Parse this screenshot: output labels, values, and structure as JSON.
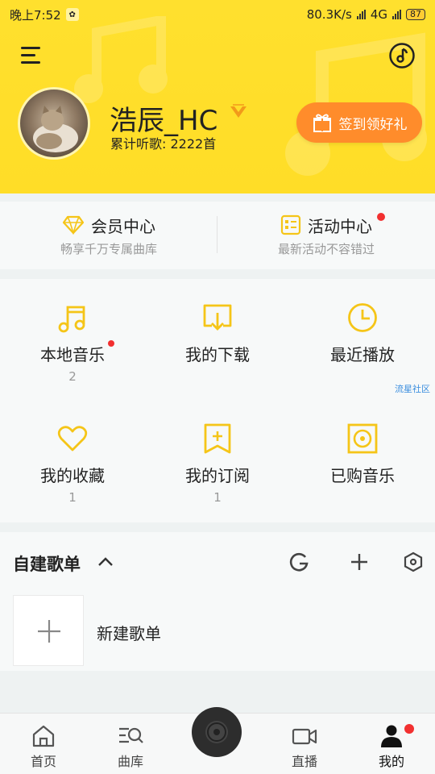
{
  "status_bar": {
    "time": "晚上7:52",
    "speed": "80.3K/s",
    "network": "4G",
    "battery": "87"
  },
  "header": {
    "username": "浩辰_HC",
    "listen_label": "累计听歌: 2222首",
    "checkin_label": "签到领好礼"
  },
  "member": {
    "vip_title": "会员中心",
    "vip_sub": "畅享千万专属曲库",
    "activity_title": "活动中心",
    "activity_sub": "最新活动不容错过"
  },
  "grid": {
    "items": [
      {
        "label": "本地音乐",
        "count": "2",
        "icon": "music-note-icon"
      },
      {
        "label": "我的下载",
        "count": "",
        "icon": "download-icon"
      },
      {
        "label": "最近播放",
        "count": "",
        "icon": "clock-icon"
      },
      {
        "label": "我的收藏",
        "count": "1",
        "icon": "heart-icon"
      },
      {
        "label": "我的订阅",
        "count": "1",
        "icon": "bookmark-plus-icon"
      },
      {
        "label": "已购音乐",
        "count": "",
        "icon": "vinyl-icon"
      }
    ],
    "community": "流星社区"
  },
  "playlist": {
    "title": "自建歌单",
    "new_label": "新建歌单"
  },
  "tabs": [
    {
      "label": "首页",
      "icon": "home-icon"
    },
    {
      "label": "曲库",
      "icon": "library-search-icon"
    },
    {
      "label": "",
      "icon": "disc-icon"
    },
    {
      "label": "直播",
      "icon": "video-icon"
    },
    {
      "label": "我的",
      "icon": "user-icon"
    }
  ],
  "colors": {
    "brand_yellow": "#ffdd27",
    "accent_orange": "#ff8c2b",
    "icon_yellow": "#f5c518",
    "badge_red": "#f23030"
  }
}
